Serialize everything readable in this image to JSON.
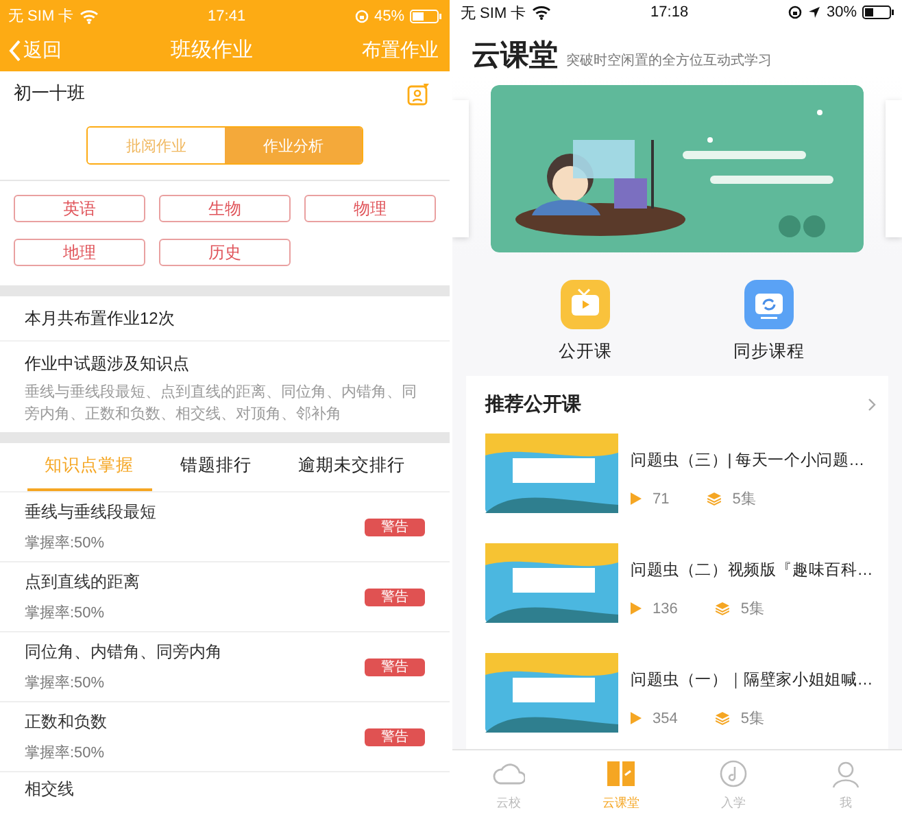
{
  "left_screen": {
    "status_bar": {
      "carrier": "无 SIM 卡",
      "time": "17:41",
      "battery": "45%"
    },
    "nav": {
      "back": "返回",
      "title": "班级作业",
      "action": "布置作业"
    },
    "class_name": "初一十班",
    "segments": [
      {
        "label": "批阅作业",
        "selected": false
      },
      {
        "label": "作业分析",
        "selected": true
      }
    ],
    "subjects": [
      "英语",
      "生物",
      "物理",
      "地理",
      "历史"
    ],
    "month_summary": "本月共布置作业12次",
    "knowledge": {
      "title": "作业中试题涉及知识点",
      "text": "垂线与垂线段最短、点到直线的距离、同位角、内错角、同旁内角、正数和负数、相交线、对顶角、邻补角"
    },
    "tabs": [
      {
        "label": "知识点掌握",
        "selected": true
      },
      {
        "label": "错题排行",
        "selected": false
      },
      {
        "label": "逾期未交排行",
        "selected": false
      }
    ],
    "items": [
      {
        "name": "垂线与垂线段最短",
        "rate": "掌握率:50%",
        "badge": "警告"
      },
      {
        "name": "点到直线的距离",
        "rate": "掌握率:50%",
        "badge": "警告"
      },
      {
        "name": "同位角、内错角、同旁内角",
        "rate": "掌握率:50%",
        "badge": "警告"
      },
      {
        "name": "正数和负数",
        "rate": "掌握率:50%",
        "badge": "警告"
      },
      {
        "name": "相交线"
      }
    ]
  },
  "right_screen": {
    "status_bar": {
      "carrier": "无 SIM 卡",
      "time": "17:18",
      "battery": "30%"
    },
    "title": "云课堂",
    "subtitle": "突破时空闲置的全方位互动式学习",
    "shortcuts": [
      {
        "label": "公开课",
        "kind": "tv"
      },
      {
        "label": "同步课程",
        "kind": "sync"
      }
    ],
    "section_title": "推荐公开课",
    "courses": [
      {
        "title": "问题虫（三）| 每天一个小问题…",
        "plays": "71",
        "episodes": "5集"
      },
      {
        "title": "问题虫（二）视频版『趣味百科…",
        "plays": "136",
        "episodes": "5集"
      },
      {
        "title": "问题虫（一）｜隔壁家小姐姐喊…",
        "plays": "354",
        "episodes": "5集"
      }
    ],
    "tab_bar": [
      {
        "label": "云校",
        "kind": "cloud",
        "selected": false
      },
      {
        "label": "云课堂",
        "kind": "book",
        "selected": true
      },
      {
        "label": "入学",
        "kind": "music",
        "selected": false
      },
      {
        "label": "我",
        "kind": "person",
        "selected": false
      }
    ]
  }
}
